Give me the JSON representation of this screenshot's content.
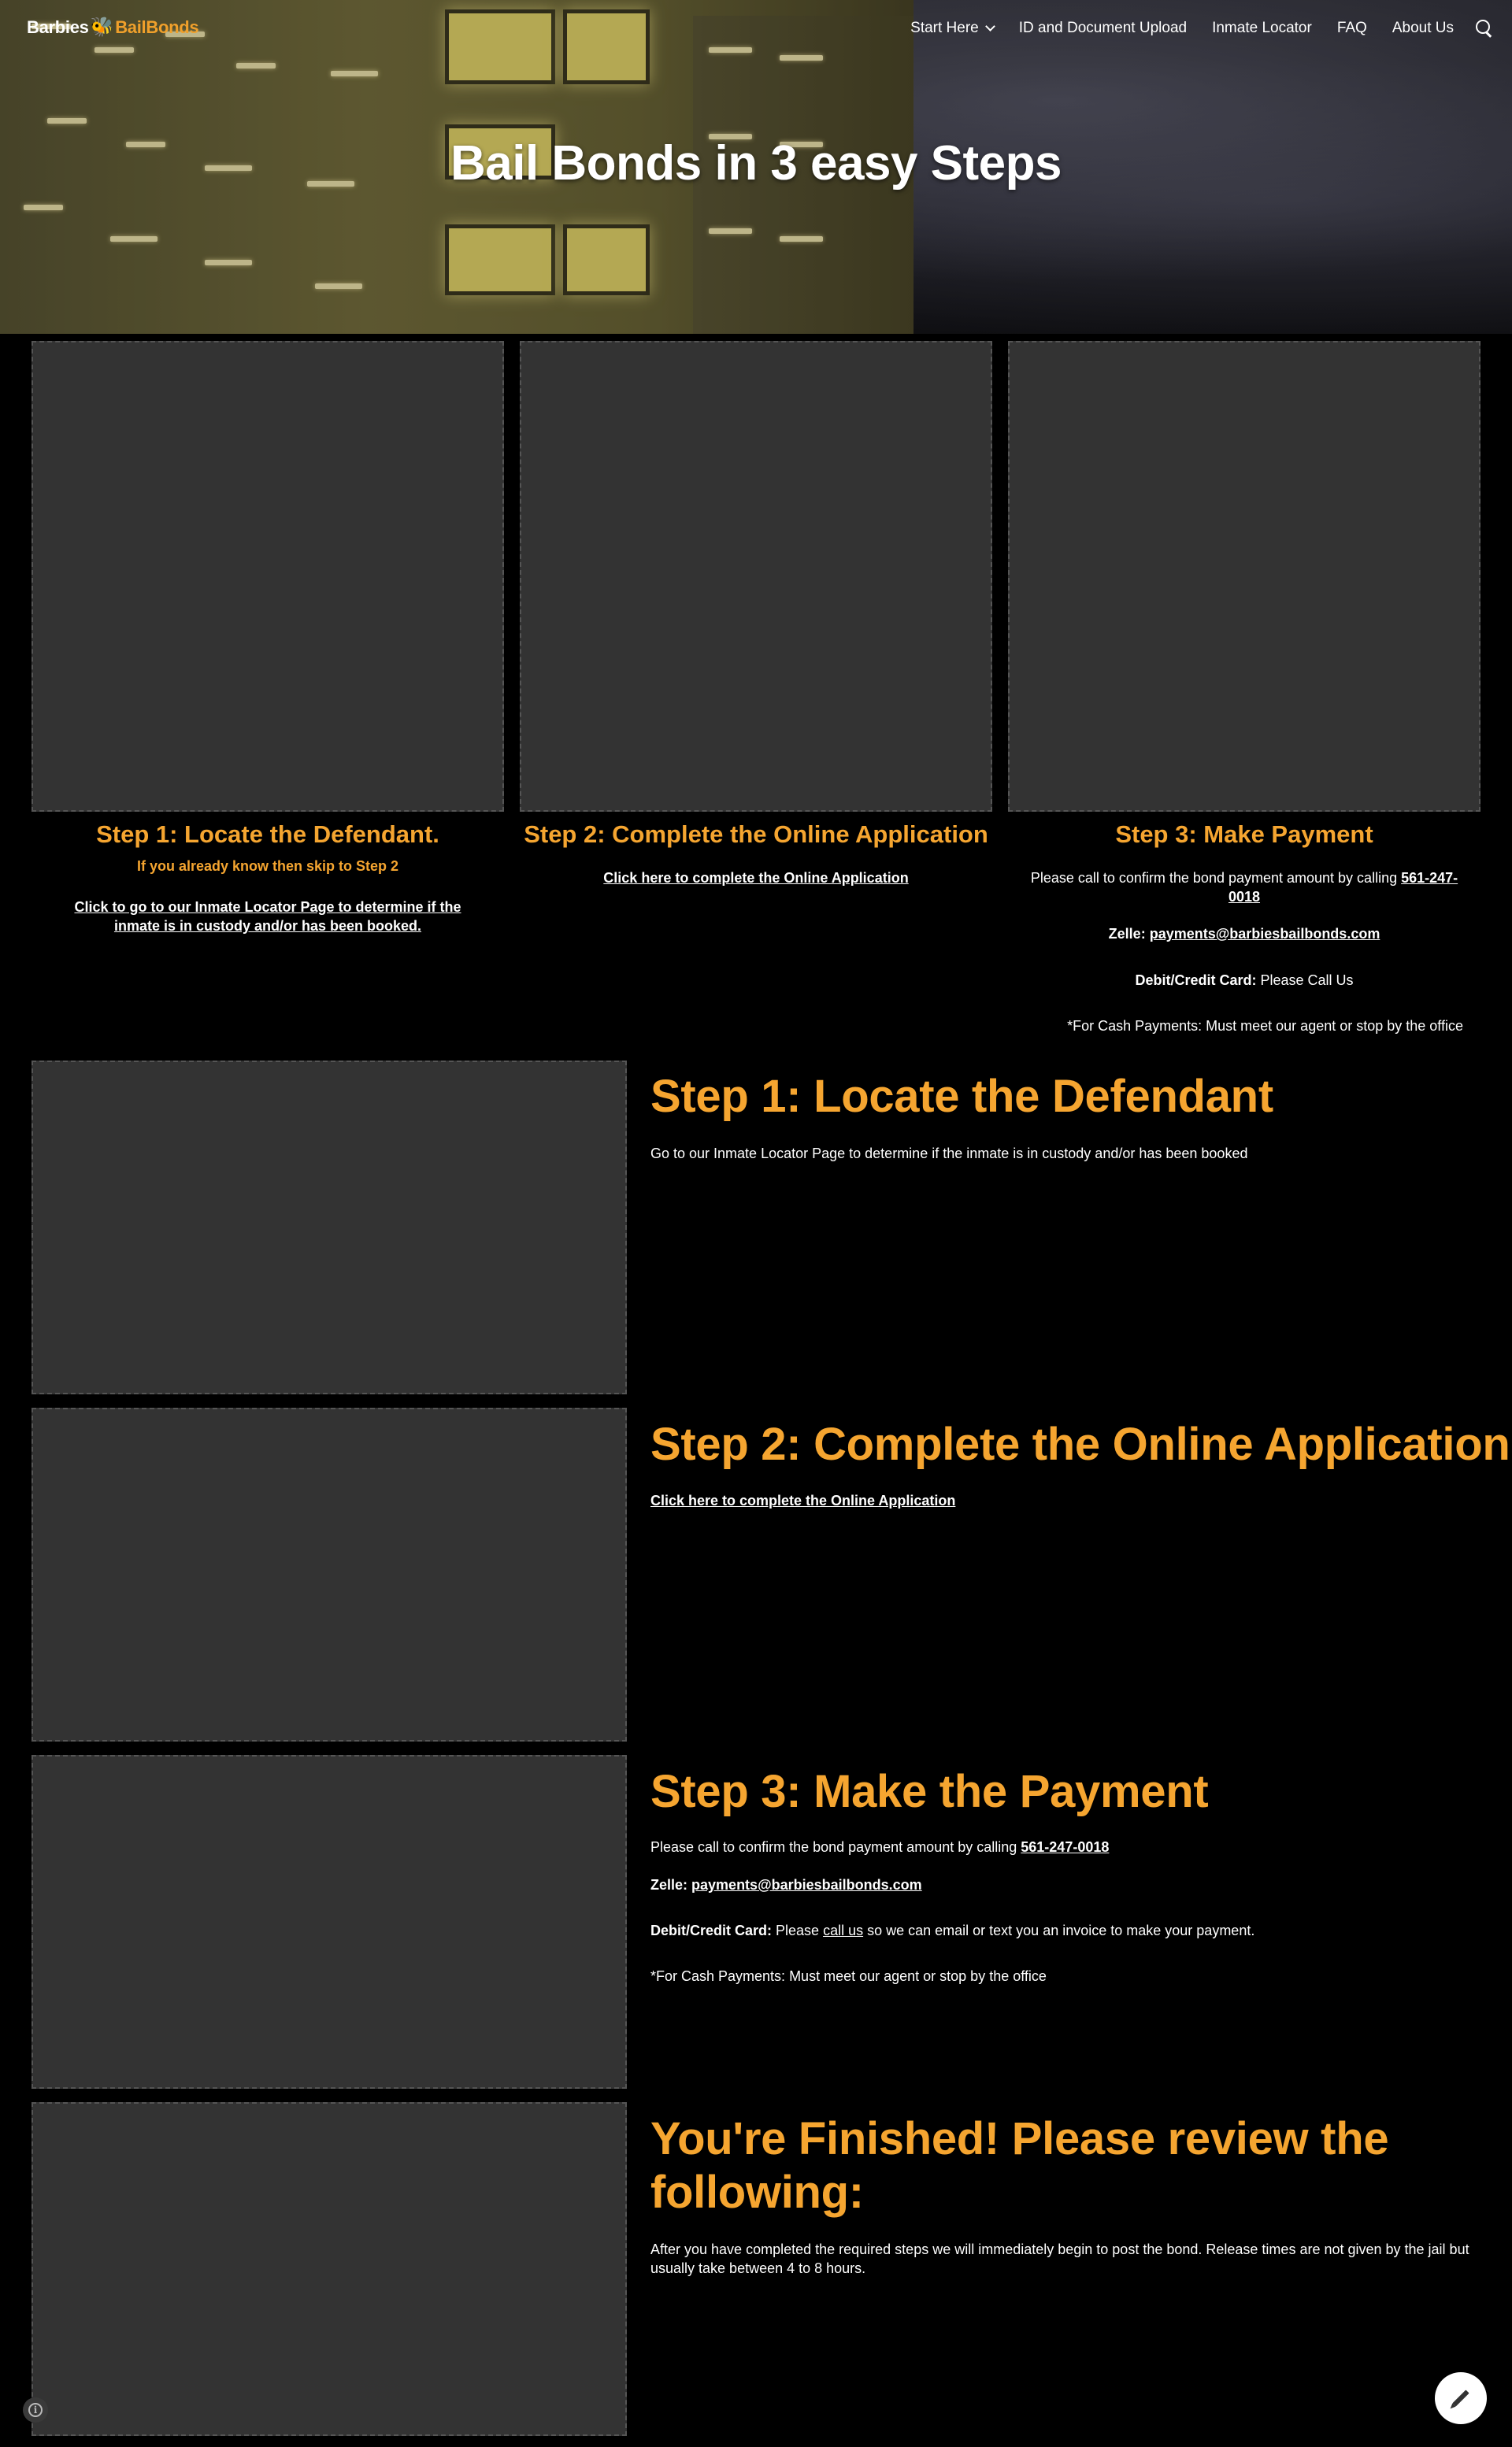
{
  "header": {
    "logo_part1": "Barbies",
    "logo_bee": "🐝",
    "logo_part2": "BailBonds",
    "nav": [
      {
        "label": "Start Here"
      },
      {
        "label": "ID and Document Upload"
      },
      {
        "label": "Inmate Locator"
      },
      {
        "label": "FAQ"
      },
      {
        "label": "About Us"
      }
    ],
    "title": "Bail Bonds in 3 easy Steps"
  },
  "columns": {
    "col1": {
      "title": "Step 1: Locate the Defendant.",
      "subtitle": "If you already know then skip to Step 2",
      "link": "Click to go to our Inmate Locator Page to determine if the inmate is in custody and/or has been booked."
    },
    "col2": {
      "title": "Step 2: Complete the Online Application",
      "link": "Click here to complete the Online Application"
    },
    "col3": {
      "title": "Step 3: Make Payment",
      "call_text": "Please call to confirm the bond payment amount by calling ",
      "phone": "561-247-0018",
      "zelle_label": "Zelle:",
      "zelle_email": "payments@barbiesbailbonds.com",
      "card_label": "Debit/Credit Card:",
      "card_text": " Please Call Us",
      "cash_text": "*For Cash Payments: Must meet our agent or stop by the office"
    }
  },
  "sections": {
    "s1": {
      "heading": "Step 1: Locate the Defendant",
      "text": "Go to our Inmate Locator Page to determine if the inmate is in custody and/or has been booked"
    },
    "s2": {
      "heading": "Step 2: Complete the Online Application",
      "link": "Click here to complete the Online Application"
    },
    "s3": {
      "heading": "Step 3: Make the Payment",
      "call_text": "Please call to confirm the bond payment amount by calling ",
      "phone": "561-247-0018",
      "zelle_label": "Zelle:",
      "zelle_email": "payments@barbiesbailbonds.com",
      "card_label": "Debit/Credit Card:",
      "card_text_a": " Please ",
      "card_link": "call us",
      "card_text_b": " so we can email or text you an invoice to make your payment.",
      "cash_text": "*For Cash Payments: Must meet our agent or stop by the office"
    },
    "s4": {
      "heading_line1": "You're Finished! Please review the",
      "heading_line2": "following:",
      "text": "After you have completed the required steps we will immediately begin to post the bond. Release times are not given by the jail but usually take between 4 to 8 hours."
    }
  },
  "footer": {
    "info_icon": "info-icon",
    "info_glyph": "i",
    "edit_icon": "pencil-icon"
  },
  "colors": {
    "accent": "#f5a530",
    "background": "#000000",
    "placeholder": "#333333"
  }
}
